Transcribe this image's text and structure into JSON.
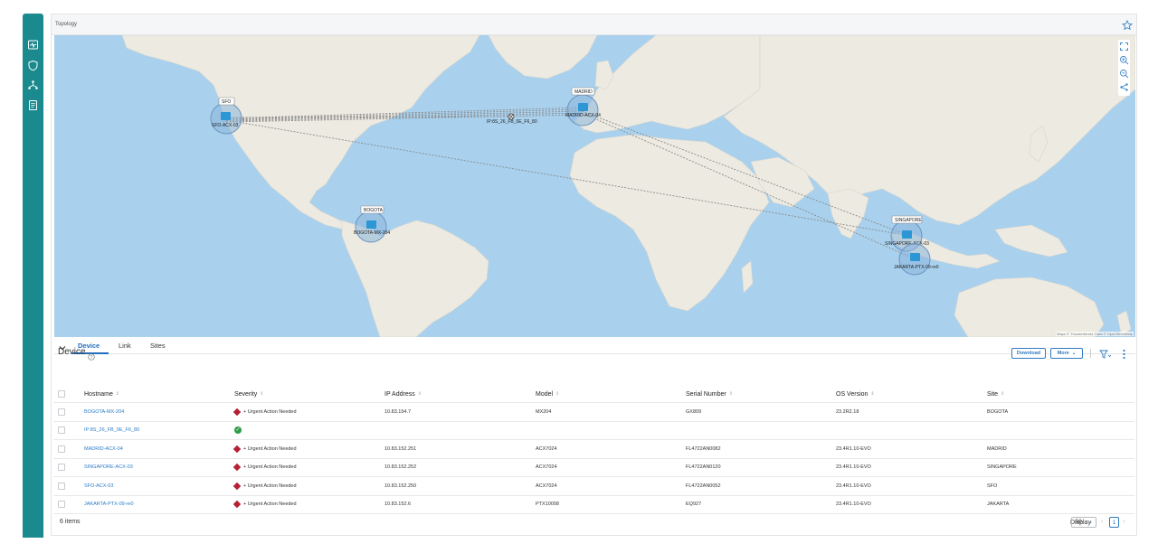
{
  "rail": {
    "items": [
      {
        "icon": "monitor-pulse-icon"
      },
      {
        "icon": "shield-icon"
      },
      {
        "icon": "network-icon"
      },
      {
        "icon": "document-icon"
      }
    ]
  },
  "topology": {
    "title": "Topology",
    "favorite_icon": "star-icon",
    "attribution": "Maps © Thunderforest, Data © OpenStreetMap",
    "tools": [
      "fit-screen-icon",
      "zoom-in-icon",
      "zoom-out-icon",
      "share-icon"
    ],
    "sites": [
      {
        "tag": "SFO",
        "device": "SFO-ACX-03"
      },
      {
        "tag": "MADRID",
        "device": "MADRID-ACX-04"
      },
      {
        "tag": "BOGOTA",
        "device": "BOGOTA-MX-204"
      },
      {
        "tag": "SINGAPORE",
        "device": "SINGAPORE-ACX-03"
      },
      {
        "tag": "",
        "device": "JAKARTA-PTX-09-re0"
      }
    ],
    "standalone_node": {
      "label": "IP:8S_26_FB_0E_F6_80",
      "icon": "device-node-icon"
    }
  },
  "tabs": [
    {
      "label": "Device",
      "active": true
    },
    {
      "label": "Link",
      "active": false
    },
    {
      "label": "Sites",
      "active": false
    }
  ],
  "device_section": {
    "title": "Device",
    "help_icon": "help-icon",
    "download_label": "Download",
    "more_label": "More",
    "filter_icon": "filter-icon",
    "kebab_icon": "kebab-icon"
  },
  "table": {
    "columns": [
      "Hostname",
      "Severity",
      "IP Address",
      "Model",
      "Serial Number",
      "OS Version",
      "Site"
    ],
    "rows": [
      {
        "hostname": "BOGOTA-MX-204",
        "severity": "+ Urgent Action Needed",
        "severity_kind": "urgent",
        "ip": "10.83.154.7",
        "model": "MX204",
        "serial": "GX809",
        "os": "23.2R2.18",
        "site": "BOGOTA"
      },
      {
        "hostname": "IP:8S_26_FB_0E_F6_80",
        "severity": "",
        "severity_kind": "ok",
        "ip": "",
        "model": "",
        "serial": "",
        "os": "",
        "site": ""
      },
      {
        "hostname": "MADRID-ACX-04",
        "severity": "+ Urgent Action Needed",
        "severity_kind": "urgent",
        "ip": "10.83.152.251",
        "model": "ACX7024",
        "serial": "FL4722AN0082",
        "os": "23.4R1.10-EVO",
        "site": "MADRID"
      },
      {
        "hostname": "SINGAPORE-ACX-03",
        "severity": "+ Urgent Action Needed",
        "severity_kind": "urgent",
        "ip": "10.83.152.252",
        "model": "ACX7024",
        "serial": "FL4722AN0120",
        "os": "23.4R1.10-EVO",
        "site": "SINGAPORE"
      },
      {
        "hostname": "SFO-ACX-03",
        "severity": "+ Urgent Action Needed",
        "severity_kind": "urgent",
        "ip": "10.83.152.250",
        "model": "ACX7024",
        "serial": "FL4722AN0052",
        "os": "23.4R1.10-EVO",
        "site": "SFO"
      },
      {
        "hostname": "JAKARTA-PTX-09-re0",
        "severity": "+ Urgent Action Needed",
        "severity_kind": "urgent",
        "ip": "10.83.152.6",
        "model": "PTX10008",
        "serial": "EQ927",
        "os": "23.4R1.10-EVO",
        "site": "JAKARTA"
      }
    ]
  },
  "footer": {
    "count": "6 items",
    "display_label": "Display",
    "page_size": "50",
    "current_page": "1"
  },
  "colors": {
    "rail": "#1b8a8f",
    "accent": "#2f7ac2",
    "urgent": "#b52133",
    "ok": "#2f9c4a",
    "water": "#a9d1ee"
  }
}
